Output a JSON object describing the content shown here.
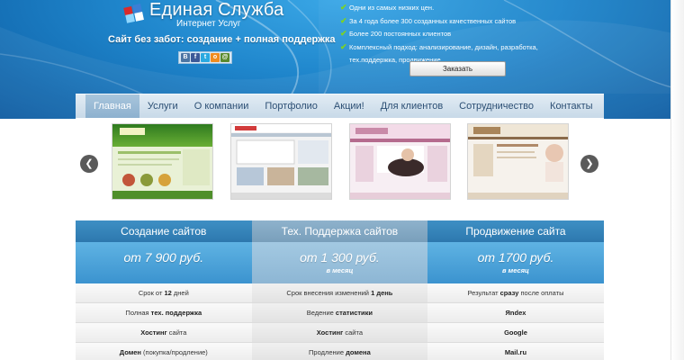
{
  "header": {
    "brand_title": "Единая Служба",
    "brand_subtitle": "Интернет Услуг",
    "slogan": "Сайт без забот: создание + полная поддержка",
    "social_icons": [
      "vkontakte-icon",
      "facebook-icon",
      "twitter-icon",
      "odnoklassniki-icon",
      "mail-icon"
    ],
    "features": [
      "Одни из самых низких цен.",
      "За 4 года более 300 созданных качественных сайтов",
      "Более 200 постоянных клиентов",
      "Комплексный подход: анализирование, дизайн, разработка,",
      "тех.поддержка, продвижение"
    ],
    "order_label": "Заказать"
  },
  "nav": {
    "items": [
      "Главная",
      "Услуги",
      "О компании",
      "Портфолио",
      "Акции!",
      "Для клиентов",
      "Сотрудничество",
      "Контакты"
    ],
    "active_index": 0
  },
  "slider": {
    "prev_icon": "chevron-left-icon",
    "next_icon": "chevron-right-icon"
  },
  "pricing": [
    {
      "title": "Создание сайтов",
      "price": "от 7 900 руб.",
      "per": "",
      "rows": [
        {
          "pre": "Срок от ",
          "bold": "12",
          "post": " дней"
        },
        {
          "pre": "Полная ",
          "bold": "тех. поддержка",
          "post": ""
        },
        {
          "pre": "",
          "bold": "Хостинг",
          "post": " сайта"
        },
        {
          "pre": "",
          "bold": "Домен",
          "post": " (покупка/продление)"
        }
      ]
    },
    {
      "title": "Тех. Поддержка сайтов",
      "price": "от 1 300 руб.",
      "per": "в месяц",
      "rows": [
        {
          "pre": "Срок внесения изменений ",
          "bold": "1 день",
          "post": ""
        },
        {
          "pre": "Ведение ",
          "bold": "статистики",
          "post": ""
        },
        {
          "pre": "",
          "bold": "Хостинг",
          "post": " сайта"
        },
        {
          "pre": "Продление ",
          "bold": "домена",
          "post": ""
        }
      ]
    },
    {
      "title": "Продвижение сайта",
      "price": "от 1700 руб.",
      "per": "в месяц",
      "rows": [
        {
          "pre": "Результат ",
          "bold": "сразу",
          "post": " после оплаты"
        },
        {
          "pre": "",
          "bold": "Яndex",
          "post": ""
        },
        {
          "pre": "",
          "bold": "Google",
          "post": ""
        },
        {
          "pre": "",
          "bold": "Mail.ru",
          "post": ""
        }
      ]
    }
  ]
}
